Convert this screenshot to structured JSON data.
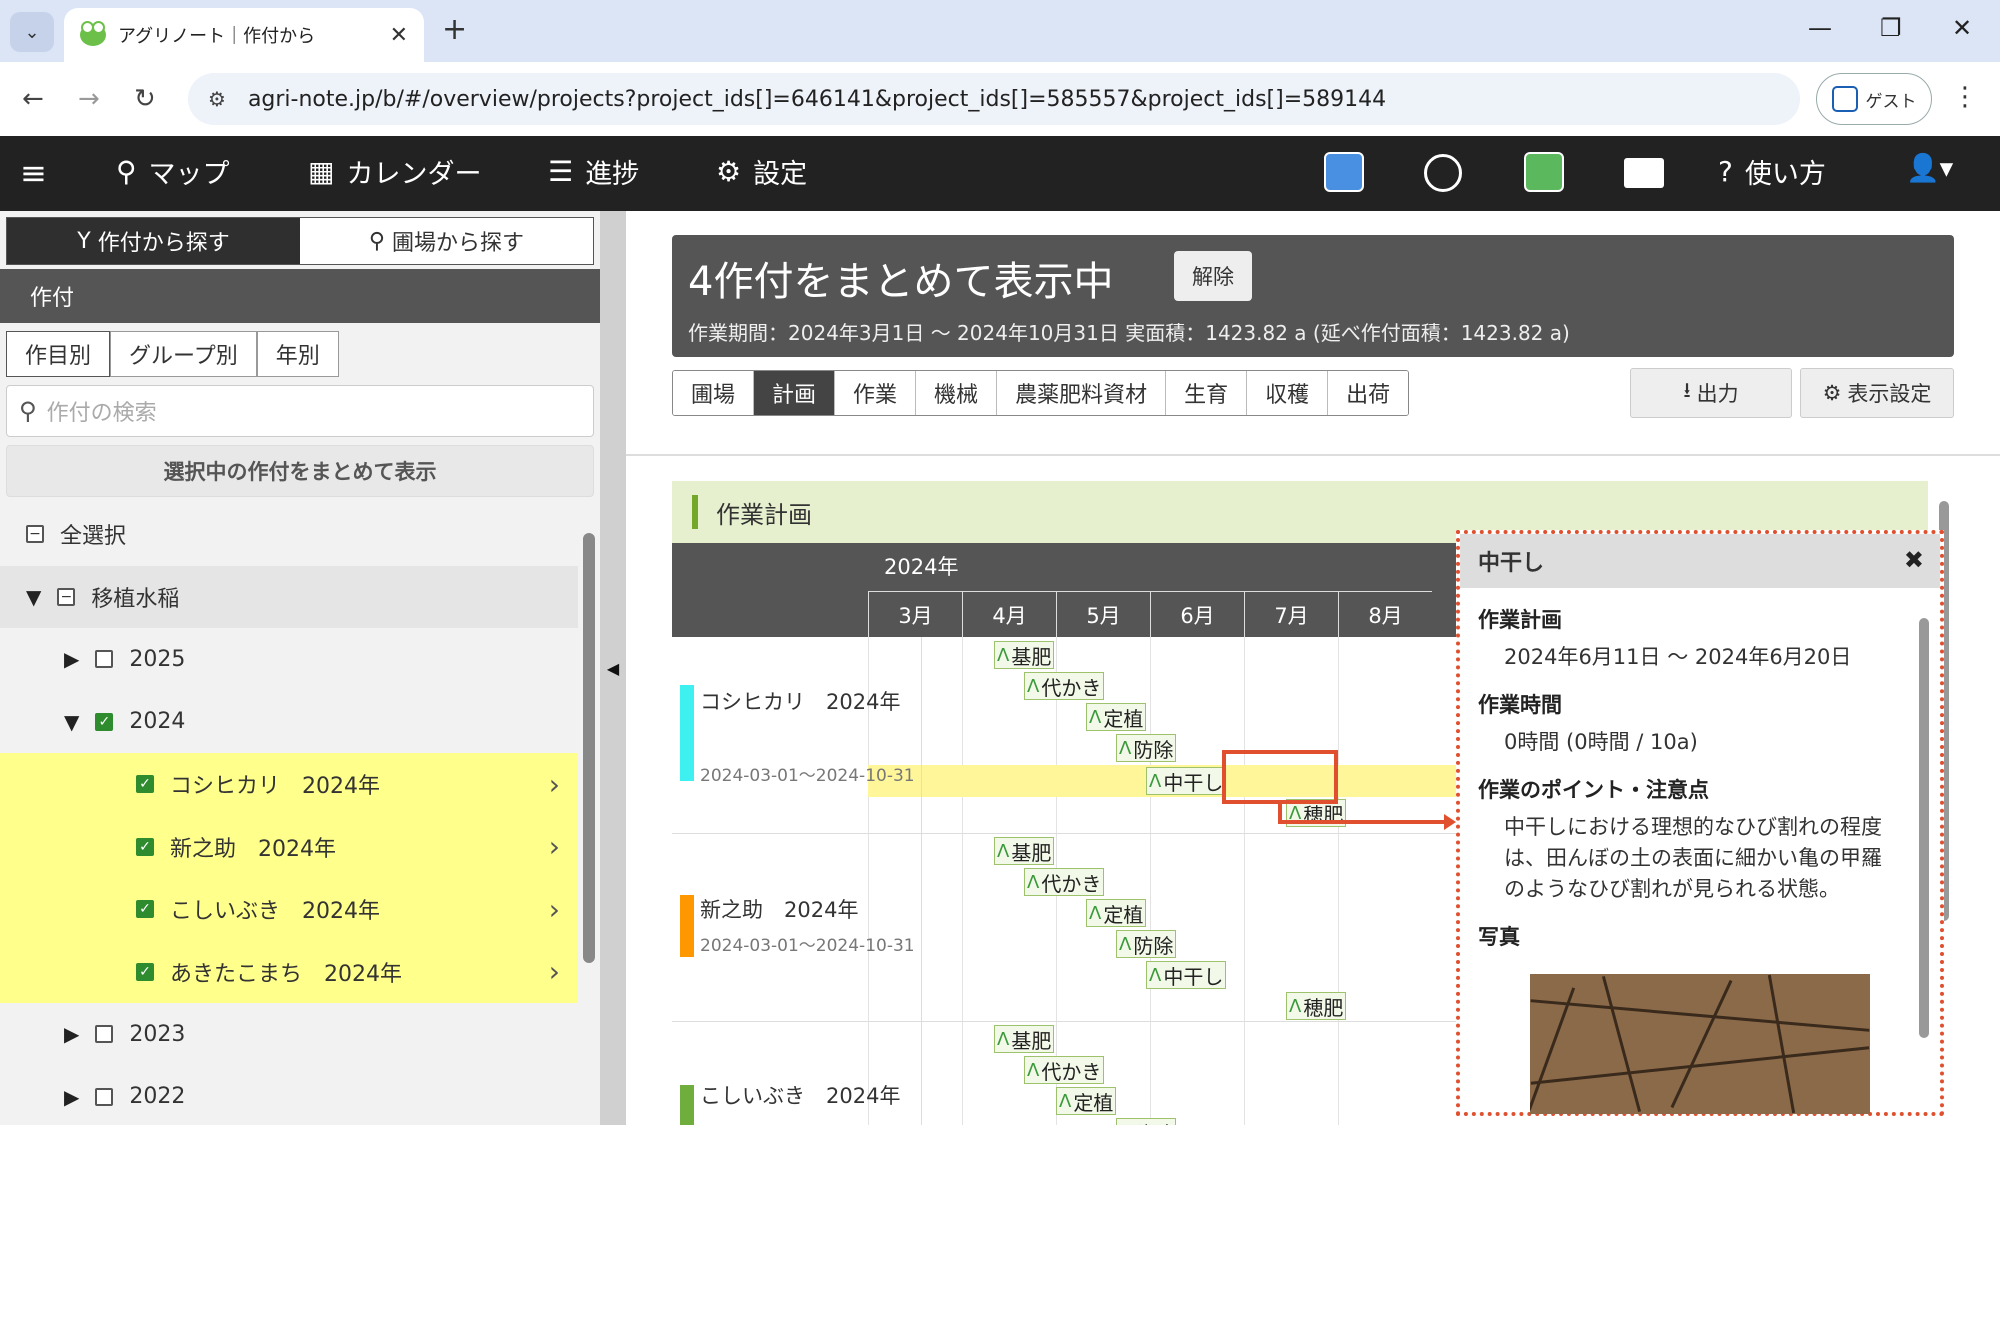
{
  "browser": {
    "tab_title": "アグリノート｜作付から",
    "url": "agri-note.jp/b/#/overview/projects?project_ids[]=646141&project_ids[]=585557&project_ids[]=589144",
    "guest_label": "ゲスト"
  },
  "nav": {
    "map": "マップ",
    "calendar": "カレンダー",
    "progress": "進捗",
    "settings": "設定",
    "help": "使い方"
  },
  "sidebar": {
    "tab_crops": "作付から探す",
    "tab_fields": "圃場から探す",
    "header": "作付",
    "group_tabs": [
      "作目別",
      "グループ別",
      "年別"
    ],
    "search_placeholder": "作付の検索",
    "combine_button": "選択中の作付をまとめて表示",
    "select_all": "全選択",
    "tree": {
      "category": "移植水稲",
      "years": [
        "2025",
        "2024",
        "2023",
        "2022"
      ],
      "crops_2024": [
        "コシヒカリ　2024年",
        "新之助　2024年",
        "こしいぶき　2024年",
        "あきたこまち　2024年"
      ]
    }
  },
  "summary": {
    "title": "4作付をまとめて表示中",
    "unset_button": "解除",
    "subtitle": "作業期間：2024年3月1日 ～ 2024年10月31日  実面積：1423.82 a (延べ作付面積：1423.82 a)"
  },
  "view_tabs": [
    "圃場",
    "計画",
    "作業",
    "機械",
    "農薬肥料資材",
    "生育",
    "収穫",
    "出荷"
  ],
  "buttons": {
    "output": "出力",
    "display_settings": "表示設定"
  },
  "plan": {
    "section_title": "作業計画",
    "year": "2024年",
    "months": [
      "3月",
      "4月",
      "5月",
      "6月",
      "7月",
      "8月"
    ],
    "rows": [
      {
        "name": "コシヒカリ　2024年",
        "date": "2024-03-01～2024-10-31",
        "color": "#3ef0f0",
        "tasks": [
          "基肥",
          "代かき",
          "定植",
          "防除",
          "中干し",
          "穂肥"
        ]
      },
      {
        "name": "新之助　2024年",
        "date": "2024-03-01～2024-10-31",
        "color": "#ff9800",
        "tasks": [
          "基肥",
          "代かき",
          "定植",
          "防除",
          "中干し",
          "穂肥"
        ]
      },
      {
        "name": "こしいぶき　2024年",
        "date": "",
        "color": "#6fae3c",
        "tasks": [
          "基肥",
          "代かき",
          "定植",
          "防除"
        ]
      }
    ]
  },
  "popup": {
    "title": "中干し",
    "plan_label": "作業計画",
    "plan_value": "2024年6月11日 ～ 2024年6月20日",
    "time_label": "作業時間",
    "time_value": "0時間 (0時間 / 10a)",
    "points_label": "作業のポイント・注意点",
    "points_value": "中干しにおける理想的なひび割れの程度は、田んぼの土の表面に細かい亀の甲羅のようなひび割れが見られる状態。",
    "photo_label": "写真"
  },
  "colors": {
    "accent_red": "#e0502e",
    "highlight_yellow": "#ffff8c",
    "plan_green": "#73a82a"
  }
}
